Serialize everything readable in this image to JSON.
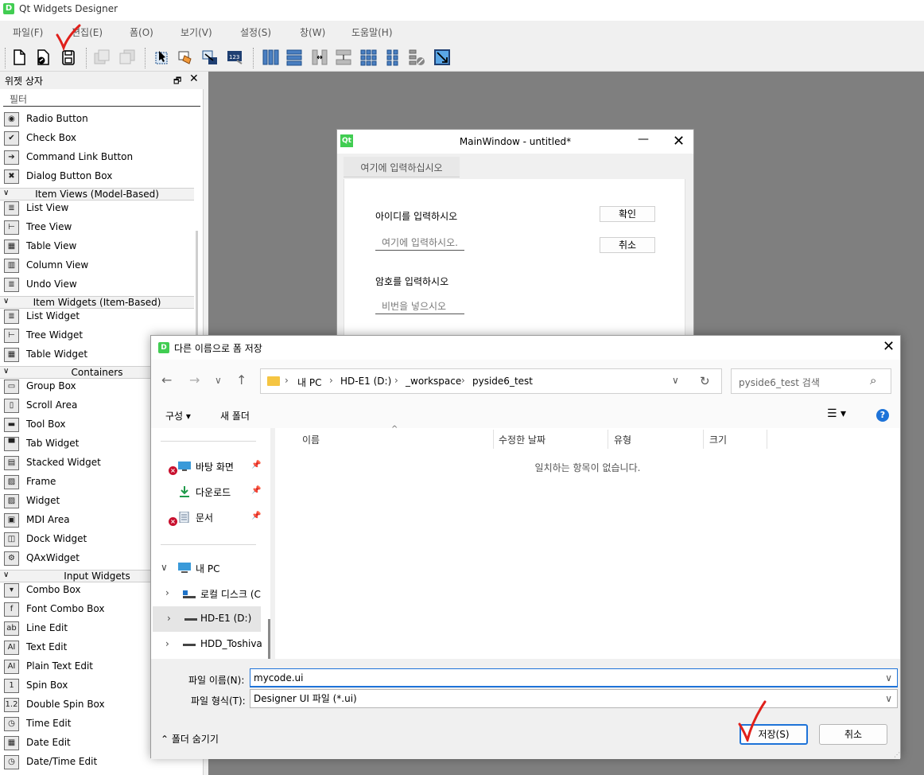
{
  "app": {
    "title": "Qt Widgets Designer",
    "logo_text": "D"
  },
  "menubar": [
    "파일(F)",
    "편집(E)",
    "폼(O)",
    "보기(V)",
    "설정(S)",
    "창(W)",
    "도움말(H)"
  ],
  "widget_box": {
    "title": "위젯 상자",
    "filter_placeholder": "필터",
    "items": [
      {
        "type": "item",
        "label": "Radio Button",
        "icon": "radio-icon",
        "glyph": "◉"
      },
      {
        "type": "item",
        "label": "Check Box",
        "icon": "checkbox-icon",
        "glyph": "✔"
      },
      {
        "type": "item",
        "label": "Command Link Button",
        "icon": "command-link-icon",
        "glyph": "➔"
      },
      {
        "type": "item",
        "label": "Dialog Button Box",
        "icon": "dialog-button-box-icon",
        "glyph": "✖"
      },
      {
        "type": "cat",
        "label": "Item Views (Model-Based)"
      },
      {
        "type": "item",
        "label": "List View",
        "icon": "list-view-icon",
        "glyph": "≣"
      },
      {
        "type": "item",
        "label": "Tree View",
        "icon": "tree-view-icon",
        "glyph": "⊢"
      },
      {
        "type": "item",
        "label": "Table View",
        "icon": "table-view-icon",
        "glyph": "▦"
      },
      {
        "type": "item",
        "label": "Column View",
        "icon": "column-view-icon",
        "glyph": "▥"
      },
      {
        "type": "item",
        "label": "Undo View",
        "icon": "undo-view-icon",
        "glyph": "≣"
      },
      {
        "type": "cat",
        "label": "Item Widgets (Item-Based)"
      },
      {
        "type": "item",
        "label": "List Widget",
        "icon": "list-widget-icon",
        "glyph": "≣"
      },
      {
        "type": "item",
        "label": "Tree Widget",
        "icon": "tree-widget-icon",
        "glyph": "⊢"
      },
      {
        "type": "item",
        "label": "Table Widget",
        "icon": "table-widget-icon",
        "glyph": "▦"
      },
      {
        "type": "cat",
        "label": "Containers"
      },
      {
        "type": "item",
        "label": "Group Box",
        "icon": "group-box-icon",
        "glyph": "▭"
      },
      {
        "type": "item",
        "label": "Scroll Area",
        "icon": "scroll-area-icon",
        "glyph": "▯"
      },
      {
        "type": "item",
        "label": "Tool Box",
        "icon": "tool-box-icon",
        "glyph": "▬"
      },
      {
        "type": "item",
        "label": "Tab Widget",
        "icon": "tab-widget-icon",
        "glyph": "▀"
      },
      {
        "type": "item",
        "label": "Stacked Widget",
        "icon": "stacked-widget-icon",
        "glyph": "▤"
      },
      {
        "type": "item",
        "label": "Frame",
        "icon": "frame-icon",
        "glyph": "▨"
      },
      {
        "type": "item",
        "label": "Widget",
        "icon": "widget-icon",
        "glyph": "▨"
      },
      {
        "type": "item",
        "label": "MDI Area",
        "icon": "mdi-area-icon",
        "glyph": "▣"
      },
      {
        "type": "item",
        "label": "Dock Widget",
        "icon": "dock-widget-icon",
        "glyph": "◫"
      },
      {
        "type": "item",
        "label": "QAxWidget",
        "icon": "qaxwidget-icon",
        "glyph": "⚙"
      },
      {
        "type": "cat",
        "label": "Input Widgets"
      },
      {
        "type": "item",
        "label": "Combo Box",
        "icon": "combo-box-icon",
        "glyph": "▾"
      },
      {
        "type": "item",
        "label": "Font Combo Box",
        "icon": "font-combo-box-icon",
        "glyph": "f"
      },
      {
        "type": "item",
        "label": "Line Edit",
        "icon": "line-edit-icon",
        "glyph": "ab"
      },
      {
        "type": "item",
        "label": "Text Edit",
        "icon": "text-edit-icon",
        "glyph": "AI"
      },
      {
        "type": "item",
        "label": "Plain Text Edit",
        "icon": "plain-text-edit-icon",
        "glyph": "AI"
      },
      {
        "type": "item",
        "label": "Spin Box",
        "icon": "spin-box-icon",
        "glyph": "1"
      },
      {
        "type": "item",
        "label": "Double Spin Box",
        "icon": "double-spin-box-icon",
        "glyph": "1.2"
      },
      {
        "type": "item",
        "label": "Time Edit",
        "icon": "time-edit-icon",
        "glyph": "◷"
      },
      {
        "type": "item",
        "label": "Date Edit",
        "icon": "date-edit-icon",
        "glyph": "▦"
      },
      {
        "type": "item",
        "label": "Date/Time Edit",
        "icon": "date-time-edit-icon",
        "glyph": "◷"
      }
    ]
  },
  "main_window": {
    "title": "MainWindow - untitled*",
    "menu_placeholder": "여기에 입력하십시오",
    "id_label": "아이디를 입력하시오",
    "id_placeholder": "여기에 입력하시오.",
    "pw_label": "암호를 입력하시오",
    "pw_placeholder": "비번을 넣으시오",
    "ok_button": "확인",
    "cancel_button": "취소"
  },
  "save_dialog": {
    "title": "다른 이름으로 폼 저장",
    "breadcrumb": [
      "내 PC",
      "HD-E1 (D:)",
      "_workspace",
      "pyside6_test"
    ],
    "search_placeholder": "pyside6_test 검색",
    "organize": "구성 ▾",
    "new_folder": "새 폴더",
    "nav": {
      "desktop": "바탕 화면",
      "downloads": "다운로드",
      "documents": "문서",
      "this_pc": "내 PC",
      "local_disk": "로컬 디스크 (C",
      "hd_e1": "HD-E1 (D:)",
      "hdd_toshiba": "HDD_Toshiva"
    },
    "columns": [
      "이름",
      "수정한 날짜",
      "유형",
      "크기"
    ],
    "empty_message": "일치하는 항목이 없습니다.",
    "filename_label": "파일 이름(N):",
    "filename_value": "mycode.ui",
    "filetype_label": "파일 형식(T):",
    "filetype_value": "Designer UI 파일 (*.ui)",
    "hide_folders": "폴더 숨기기",
    "save_button": "저장(S)",
    "cancel_button": "취소"
  },
  "colors": {
    "accent": "#1e73d8",
    "qt_green": "#41cd52",
    "annotation_red": "#e0201b",
    "canvas_gray": "#7f7f7f"
  }
}
